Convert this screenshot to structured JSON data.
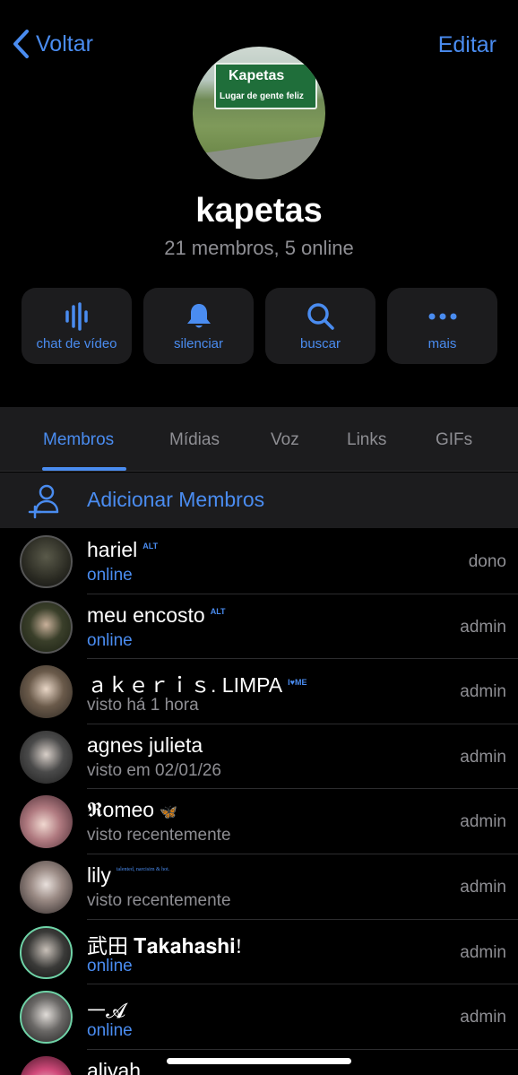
{
  "nav": {
    "back_label": "Voltar",
    "edit_label": "Editar"
  },
  "group": {
    "avatar_sign_title": "Kapetas",
    "avatar_sign_subtitle": "Lugar de gente feliz",
    "name": "kapetas",
    "subtitle": "21 membros, 5 online"
  },
  "actions": [
    {
      "label": "chat de vídeo",
      "icon": "voice-chat-icon"
    },
    {
      "label": "silenciar",
      "icon": "bell-icon"
    },
    {
      "label": "buscar",
      "icon": "search-icon"
    },
    {
      "label": "mais",
      "icon": "more-icon"
    }
  ],
  "tabs": [
    "Membros",
    "Mídias",
    "Voz",
    "Links",
    "GIFs"
  ],
  "add_members_label": "Adicionar Membros",
  "members": [
    {
      "name": "hariel",
      "badge": "ALT",
      "status": "online",
      "role": "dono"
    },
    {
      "name": "meu encosto",
      "badge": "ALT",
      "status": "online",
      "role": "admin"
    },
    {
      "name": "ａｋｅｒｉｓ. LIMPA",
      "badge": "I♥ME",
      "status": "visto há 1 hora",
      "role": "admin"
    },
    {
      "name": "agnes julieta",
      "badge": "",
      "status": "visto em 02/01/26",
      "role": "admin"
    },
    {
      "name": "𝕽omeo",
      "badge": "",
      "status": "visto recentemente",
      "role": "admin"
    },
    {
      "name": "lily",
      "badge": "talented, narcisim & hot.",
      "status": "visto recentemente",
      "role": "admin"
    },
    {
      "name": "武田 𝐓𝐚𝐤𝐚𝐡𝐚𝐬𝐡𝐢!",
      "badge": "",
      "status": "online",
      "role": "admin"
    },
    {
      "name": "ㅡ𝓐",
      "badge": "",
      "status": "online",
      "role": "admin"
    },
    {
      "name": "aliyah",
      "badge": "",
      "status": "",
      "role": ""
    }
  ],
  "colors": {
    "accent": "#4a8cf0",
    "background": "#000000",
    "card": "#1c1c1e",
    "muted": "#8e8e93"
  }
}
